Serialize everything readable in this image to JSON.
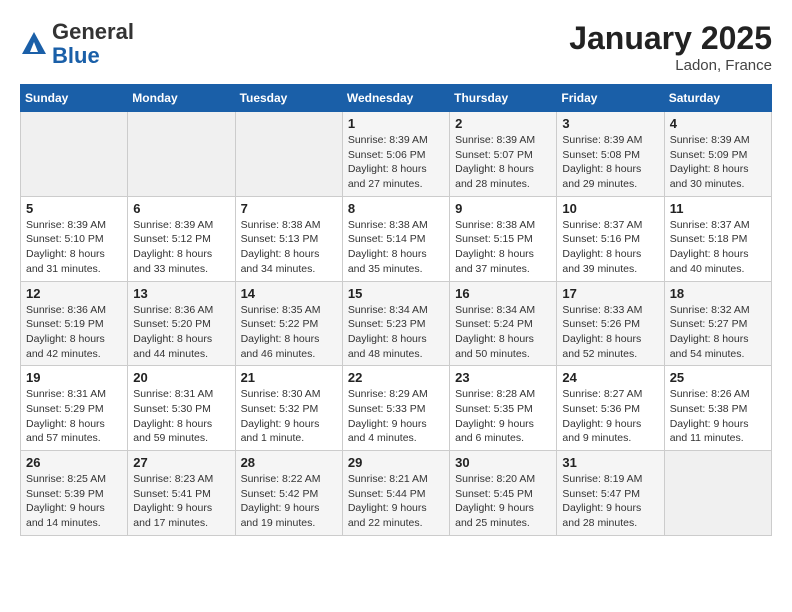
{
  "header": {
    "logo_general": "General",
    "logo_blue": "Blue",
    "month": "January 2025",
    "location": "Ladon, France"
  },
  "weekdays": [
    "Sunday",
    "Monday",
    "Tuesday",
    "Wednesday",
    "Thursday",
    "Friday",
    "Saturday"
  ],
  "weeks": [
    [
      {
        "day": "",
        "info": ""
      },
      {
        "day": "",
        "info": ""
      },
      {
        "day": "",
        "info": ""
      },
      {
        "day": "1",
        "info": "Sunrise: 8:39 AM\nSunset: 5:06 PM\nDaylight: 8 hours\nand 27 minutes."
      },
      {
        "day": "2",
        "info": "Sunrise: 8:39 AM\nSunset: 5:07 PM\nDaylight: 8 hours\nand 28 minutes."
      },
      {
        "day": "3",
        "info": "Sunrise: 8:39 AM\nSunset: 5:08 PM\nDaylight: 8 hours\nand 29 minutes."
      },
      {
        "day": "4",
        "info": "Sunrise: 8:39 AM\nSunset: 5:09 PM\nDaylight: 8 hours\nand 30 minutes."
      }
    ],
    [
      {
        "day": "5",
        "info": "Sunrise: 8:39 AM\nSunset: 5:10 PM\nDaylight: 8 hours\nand 31 minutes."
      },
      {
        "day": "6",
        "info": "Sunrise: 8:39 AM\nSunset: 5:12 PM\nDaylight: 8 hours\nand 33 minutes."
      },
      {
        "day": "7",
        "info": "Sunrise: 8:38 AM\nSunset: 5:13 PM\nDaylight: 8 hours\nand 34 minutes."
      },
      {
        "day": "8",
        "info": "Sunrise: 8:38 AM\nSunset: 5:14 PM\nDaylight: 8 hours\nand 35 minutes."
      },
      {
        "day": "9",
        "info": "Sunrise: 8:38 AM\nSunset: 5:15 PM\nDaylight: 8 hours\nand 37 minutes."
      },
      {
        "day": "10",
        "info": "Sunrise: 8:37 AM\nSunset: 5:16 PM\nDaylight: 8 hours\nand 39 minutes."
      },
      {
        "day": "11",
        "info": "Sunrise: 8:37 AM\nSunset: 5:18 PM\nDaylight: 8 hours\nand 40 minutes."
      }
    ],
    [
      {
        "day": "12",
        "info": "Sunrise: 8:36 AM\nSunset: 5:19 PM\nDaylight: 8 hours\nand 42 minutes."
      },
      {
        "day": "13",
        "info": "Sunrise: 8:36 AM\nSunset: 5:20 PM\nDaylight: 8 hours\nand 44 minutes."
      },
      {
        "day": "14",
        "info": "Sunrise: 8:35 AM\nSunset: 5:22 PM\nDaylight: 8 hours\nand 46 minutes."
      },
      {
        "day": "15",
        "info": "Sunrise: 8:34 AM\nSunset: 5:23 PM\nDaylight: 8 hours\nand 48 minutes."
      },
      {
        "day": "16",
        "info": "Sunrise: 8:34 AM\nSunset: 5:24 PM\nDaylight: 8 hours\nand 50 minutes."
      },
      {
        "day": "17",
        "info": "Sunrise: 8:33 AM\nSunset: 5:26 PM\nDaylight: 8 hours\nand 52 minutes."
      },
      {
        "day": "18",
        "info": "Sunrise: 8:32 AM\nSunset: 5:27 PM\nDaylight: 8 hours\nand 54 minutes."
      }
    ],
    [
      {
        "day": "19",
        "info": "Sunrise: 8:31 AM\nSunset: 5:29 PM\nDaylight: 8 hours\nand 57 minutes."
      },
      {
        "day": "20",
        "info": "Sunrise: 8:31 AM\nSunset: 5:30 PM\nDaylight: 8 hours\nand 59 minutes."
      },
      {
        "day": "21",
        "info": "Sunrise: 8:30 AM\nSunset: 5:32 PM\nDaylight: 9 hours\nand 1 minute."
      },
      {
        "day": "22",
        "info": "Sunrise: 8:29 AM\nSunset: 5:33 PM\nDaylight: 9 hours\nand 4 minutes."
      },
      {
        "day": "23",
        "info": "Sunrise: 8:28 AM\nSunset: 5:35 PM\nDaylight: 9 hours\nand 6 minutes."
      },
      {
        "day": "24",
        "info": "Sunrise: 8:27 AM\nSunset: 5:36 PM\nDaylight: 9 hours\nand 9 minutes."
      },
      {
        "day": "25",
        "info": "Sunrise: 8:26 AM\nSunset: 5:38 PM\nDaylight: 9 hours\nand 11 minutes."
      }
    ],
    [
      {
        "day": "26",
        "info": "Sunrise: 8:25 AM\nSunset: 5:39 PM\nDaylight: 9 hours\nand 14 minutes."
      },
      {
        "day": "27",
        "info": "Sunrise: 8:23 AM\nSunset: 5:41 PM\nDaylight: 9 hours\nand 17 minutes."
      },
      {
        "day": "28",
        "info": "Sunrise: 8:22 AM\nSunset: 5:42 PM\nDaylight: 9 hours\nand 19 minutes."
      },
      {
        "day": "29",
        "info": "Sunrise: 8:21 AM\nSunset: 5:44 PM\nDaylight: 9 hours\nand 22 minutes."
      },
      {
        "day": "30",
        "info": "Sunrise: 8:20 AM\nSunset: 5:45 PM\nDaylight: 9 hours\nand 25 minutes."
      },
      {
        "day": "31",
        "info": "Sunrise: 8:19 AM\nSunset: 5:47 PM\nDaylight: 9 hours\nand 28 minutes."
      },
      {
        "day": "",
        "info": ""
      }
    ]
  ]
}
